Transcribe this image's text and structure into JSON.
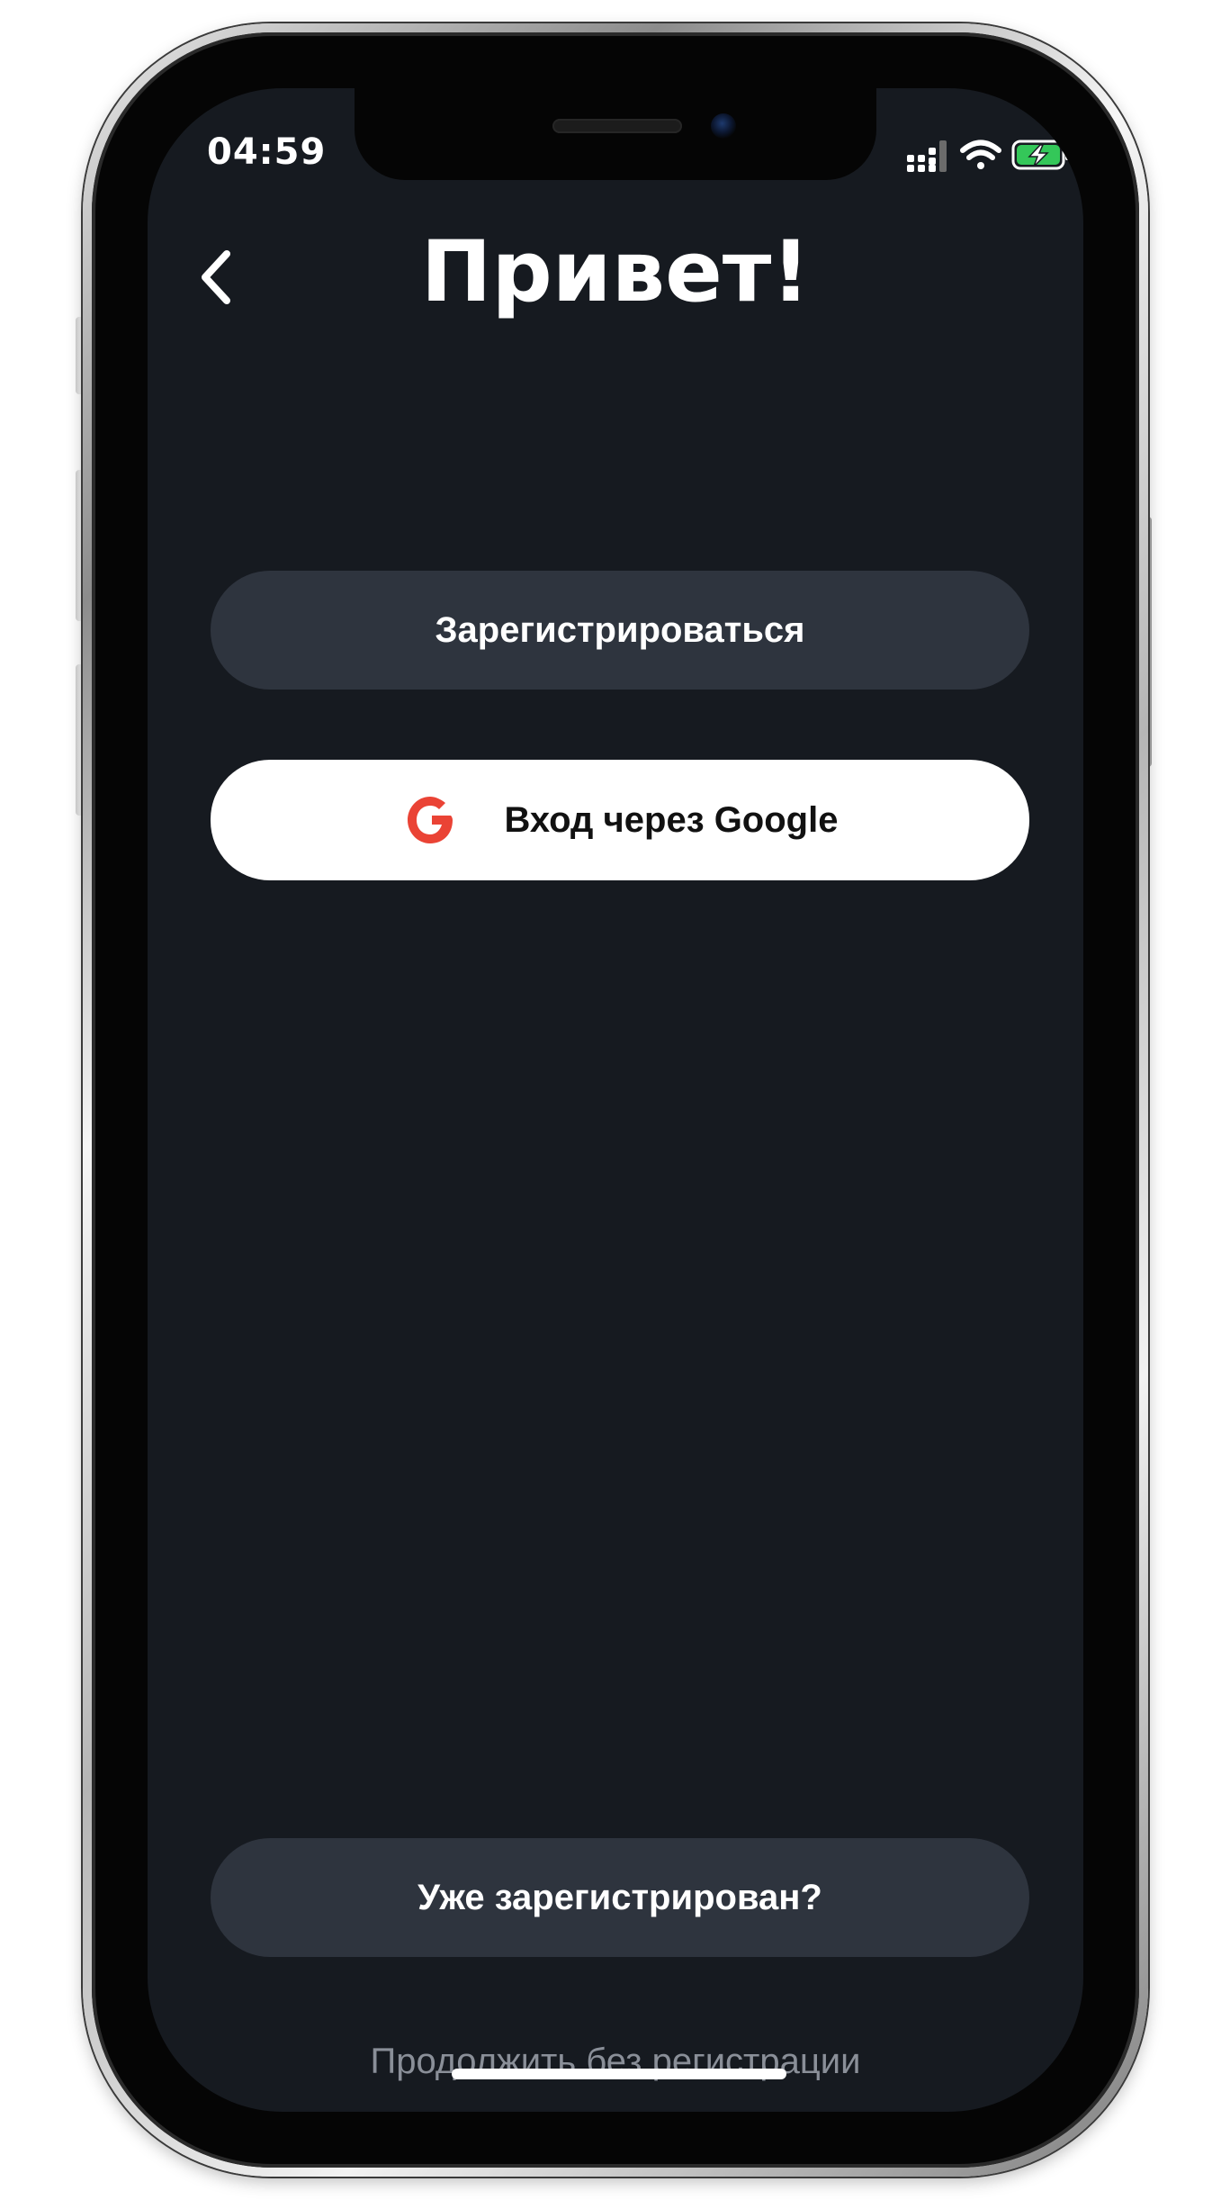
{
  "status_bar": {
    "time": "04:59"
  },
  "header": {
    "title": "Привет!"
  },
  "buttons": {
    "register_label": "Зарегистрироваться",
    "google_label": "Вход через Google",
    "already_registered_label": "Уже зарегистрирован?"
  },
  "links": {
    "continue_without_registration": "Продолжить без регистрации"
  },
  "icons": {
    "back": "chevron-left-icon",
    "google": "google-g-icon",
    "signal": "cellular-signal-icon",
    "wifi": "wifi-icon",
    "battery": "battery-charging-icon"
  },
  "colors": {
    "screen_background": "#161a20",
    "dark_button": "#2e343e",
    "google_red": "#ea4335",
    "battery_green": "#34c759",
    "muted_text": "#8a8f98"
  }
}
